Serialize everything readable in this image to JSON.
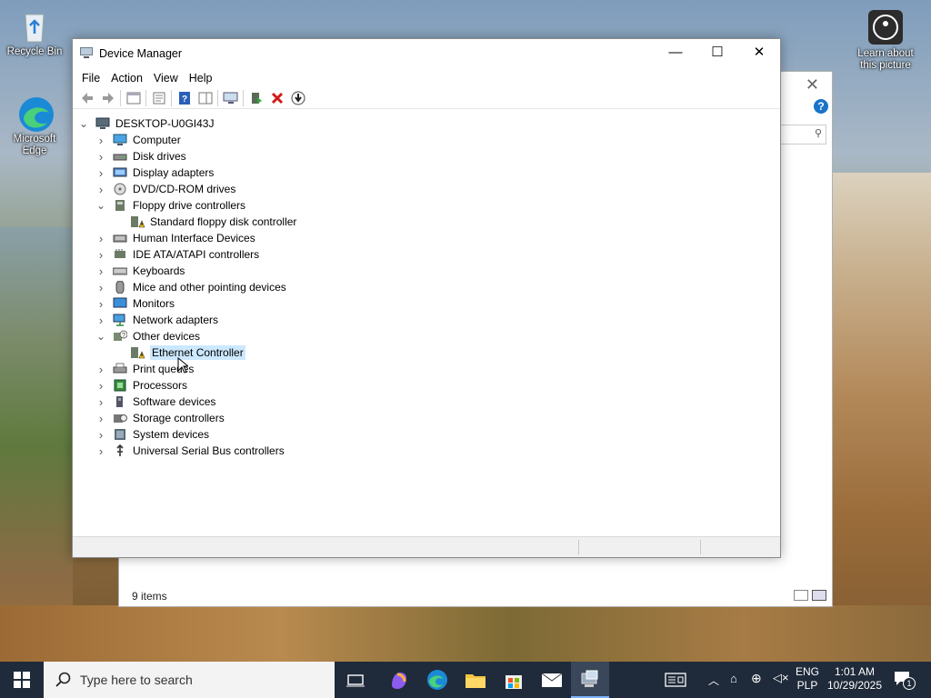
{
  "desktop": {
    "icons": [
      {
        "label": "Recycle Bin"
      },
      {
        "label": "Microsoft Edge"
      },
      {
        "label": "Learn about this picture"
      }
    ]
  },
  "background_window": {
    "status": "9 items"
  },
  "window": {
    "title": "Device Manager",
    "controls": {
      "minimize": "—",
      "maximize": "☐",
      "close": "✕"
    }
  },
  "menu": [
    "File",
    "Action",
    "View",
    "Help"
  ],
  "tree": {
    "root": "DESKTOP-U0GI43J",
    "items": [
      {
        "label": "Computer",
        "icon": "computer-icon",
        "expanded": false
      },
      {
        "label": "Disk drives",
        "icon": "disk-drive-icon",
        "expanded": false
      },
      {
        "label": "Display adapters",
        "icon": "display-adapter-icon",
        "expanded": false
      },
      {
        "label": "DVD/CD-ROM drives",
        "icon": "dvd-icon",
        "expanded": false
      },
      {
        "label": "Floppy drive controllers",
        "icon": "floppy-controller-icon",
        "expanded": true,
        "children": [
          {
            "label": "Standard floppy disk controller",
            "icon": "warning-device-icon"
          }
        ]
      },
      {
        "label": "Human Interface Devices",
        "icon": "hid-icon",
        "expanded": false
      },
      {
        "label": "IDE ATA/ATAPI controllers",
        "icon": "ide-controller-icon",
        "expanded": false
      },
      {
        "label": "Keyboards",
        "icon": "keyboard-icon",
        "expanded": false
      },
      {
        "label": "Mice and other pointing devices",
        "icon": "mouse-icon",
        "expanded": false
      },
      {
        "label": "Monitors",
        "icon": "monitor-icon",
        "expanded": false
      },
      {
        "label": "Network adapters",
        "icon": "network-adapter-icon",
        "expanded": false
      },
      {
        "label": "Other devices",
        "icon": "unknown-device-icon",
        "expanded": true,
        "children": [
          {
            "label": "Ethernet Controller",
            "icon": "warning-device-icon",
            "selected": true
          }
        ]
      },
      {
        "label": "Print queues",
        "icon": "printer-icon",
        "expanded": false
      },
      {
        "label": "Processors",
        "icon": "processor-icon",
        "expanded": false
      },
      {
        "label": "Software devices",
        "icon": "software-device-icon",
        "expanded": false
      },
      {
        "label": "Storage controllers",
        "icon": "storage-controller-icon",
        "expanded": false
      },
      {
        "label": "System devices",
        "icon": "system-device-icon",
        "expanded": false
      },
      {
        "label": "Universal Serial Bus controllers",
        "icon": "usb-icon",
        "expanded": false
      }
    ]
  },
  "taskbar": {
    "search_placeholder": "Type here to search",
    "lang_top": "ENG",
    "lang_bottom": "PLP",
    "time": "1:01 AM",
    "date": "10/29/2025",
    "notification_count": "1"
  },
  "colors": {
    "selection": "#cce8ff",
    "taskbar": "#1f2a3a",
    "delete_red": "#d11a1a",
    "help_blue": "#1a73c8"
  }
}
